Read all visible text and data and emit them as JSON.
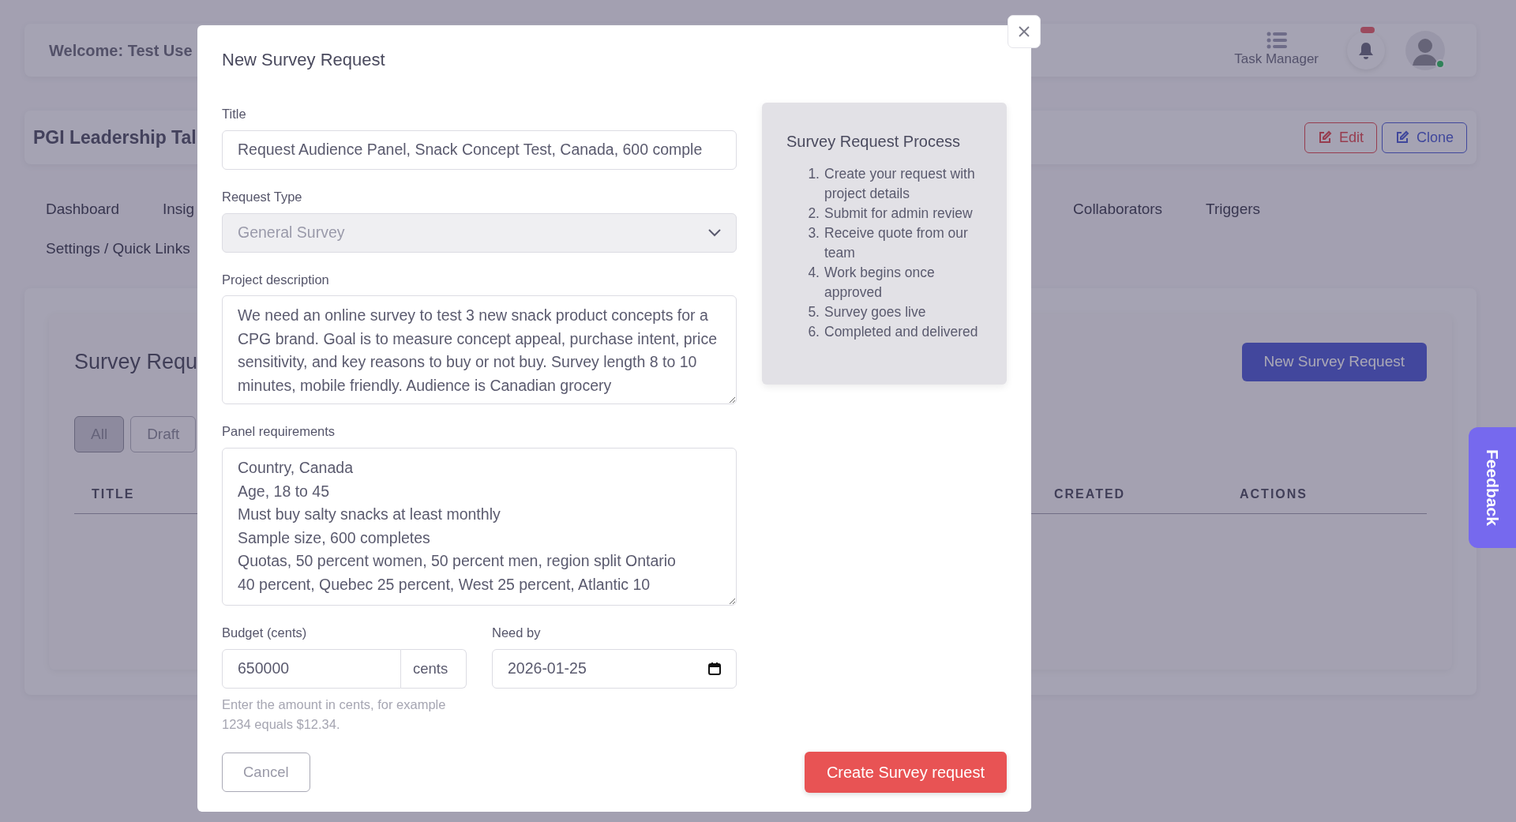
{
  "header": {
    "welcome": "Welcome: Test Use",
    "task_manager": "Task Manager"
  },
  "project": {
    "title": "PGI Leadership Tal",
    "buttons": [
      {
        "label": "Edit",
        "kind": "edit"
      },
      {
        "label": "Clone",
        "kind": "clone"
      }
    ]
  },
  "nav": {
    "items_left": [
      "Dashboard",
      "Insig"
    ],
    "items_right": [
      "Collaborators",
      "Triggers"
    ],
    "items_second_row": [
      "Settings / Quick Links"
    ]
  },
  "survey_list": {
    "heading": "Survey Requ",
    "new_button": "New Survey Request",
    "filters": [
      {
        "label": "All",
        "selected": true
      },
      {
        "label": "Draft",
        "selected": false
      }
    ],
    "columns": [
      "TITLE",
      "CREATED",
      "ACTIONS"
    ]
  },
  "feedback": "Feedback",
  "modal": {
    "title": "New Survey Request",
    "fields": [
      {
        "kind": "text",
        "label": "Title",
        "value": "Request Audience Panel, Snack Concept Test, Canada, 600 comple"
      },
      {
        "kind": "select",
        "label": "Request Type",
        "value": "General Survey",
        "disabled": true
      },
      {
        "kind": "textarea",
        "label": "Project description",
        "value": "We need an online survey to test 3 new snack product concepts for a CPG brand. Goal is to measure concept appeal, purchase intent, price sensitivity, and key reasons to buy or not buy. Survey length 8 to 10 minutes, mobile friendly. Audience is Canadian grocery"
      },
      {
        "kind": "textarea-lines",
        "label": "Panel requirements",
        "lines": [
          "Country, Canada",
          "Age, 18 to 45",
          "Must buy salty snacks at least monthly",
          "Sample size, 600 completes",
          "Quotas, 50 percent women, 50 percent men, region split Ontario",
          "40 percent, Quebec 25 percent, West 25 percent, Atlantic 10"
        ]
      }
    ],
    "budget": {
      "label": "Budget (cents)",
      "value": "650000",
      "unit": "cents",
      "help": "Enter the amount in cents, for example 1234 equals $12.34."
    },
    "need_by": {
      "label": "Need by",
      "value": "2026-01-25"
    },
    "process": {
      "title": "Survey Request Process",
      "steps": [
        {
          "number": "1.",
          "text": "Create your request with project details"
        },
        {
          "number": "2.",
          "text": "Submit for admin review"
        },
        {
          "number": "3.",
          "text": "Receive quote from our team"
        },
        {
          "number": "4.",
          "text": "Work begins once approved"
        },
        {
          "number": "5.",
          "text": "Survey goes live"
        },
        {
          "number": "6.",
          "text": "Completed and delivered"
        }
      ]
    },
    "cancel": "Cancel",
    "submit": "Create Survey request"
  }
}
